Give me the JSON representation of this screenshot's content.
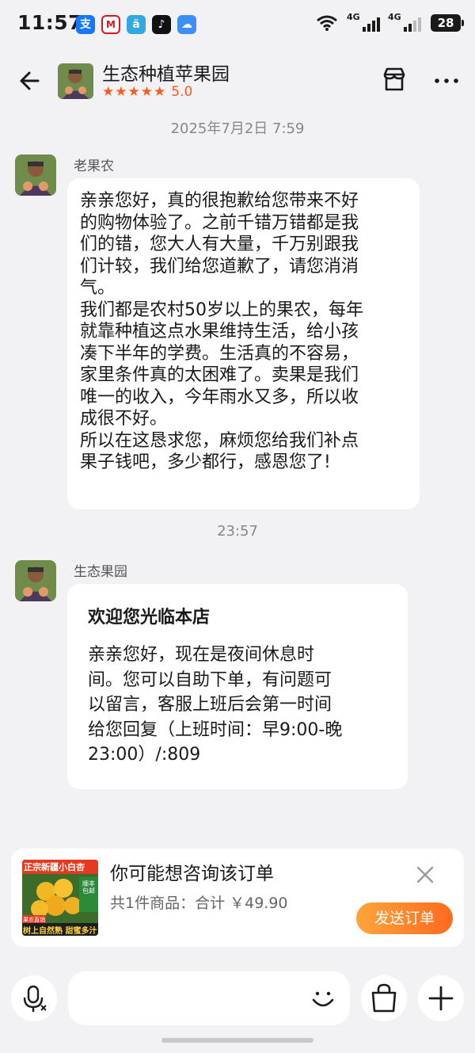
{
  "status_bar": {
    "time": "11:57",
    "battery": "28",
    "network_1": "4G",
    "network_2": "4G",
    "app_icons": [
      "alipay-icon",
      "metro-icon",
      "app-icon",
      "tiktok-icon",
      "weather-icon"
    ]
  },
  "header": {
    "shop_name": "生态种植苹果园",
    "rating": "5.0",
    "stars": 5
  },
  "messages": [
    {
      "timestamp": "2025年7月2日 7:59",
      "sender": "老果农",
      "text": "亲亲您好，真的很抱歉给您带来不好\n的购物体验了。之前千错万错都是我\n们的错，您大人有大量，千万别跟我\n们计较，我们给您道歉了，请您消消\n气。\n我们都是农村50岁以上的果农，每年\n就靠种植这点水果维持生活，给小孩\n凑下半年的学费。生活真的不容易，\n家里条件真的太困难了。卖果是我们\n唯一的收入，今年雨水又多，所以收\n成很不好。\n所以在这恳求您，麻烦您给我们补点\n果子钱吧，多少都行，感恩您了!"
    },
    {
      "timestamp": "23:57",
      "sender": "生态果园",
      "title": "欢迎您光临本店",
      "text": "亲亲您好，现在是夜间休息时\n间。您可以自助下单，有问题可\n以留言，客服上班后会第一时间\n给您回复（上班时间：早9:00-晚\n23:00）/:809"
    }
  ],
  "order_card": {
    "title": "你可能想咨询该订单",
    "summary": "共1件商品：合计 ￥49.90",
    "send_button": "发送订单",
    "thumb_banner": "正宗新疆小白杏",
    "thumb_badge_1": "果农直销",
    "thumb_side_label": "顺丰包邮",
    "thumb_footer": "树上自然熟 甜蜜多汁"
  },
  "colors": {
    "accent": "#ff5b1f",
    "button_gradient_start": "#ffa53a",
    "button_gradient_end": "#ff6a1f",
    "background": "#f2f2f4"
  }
}
